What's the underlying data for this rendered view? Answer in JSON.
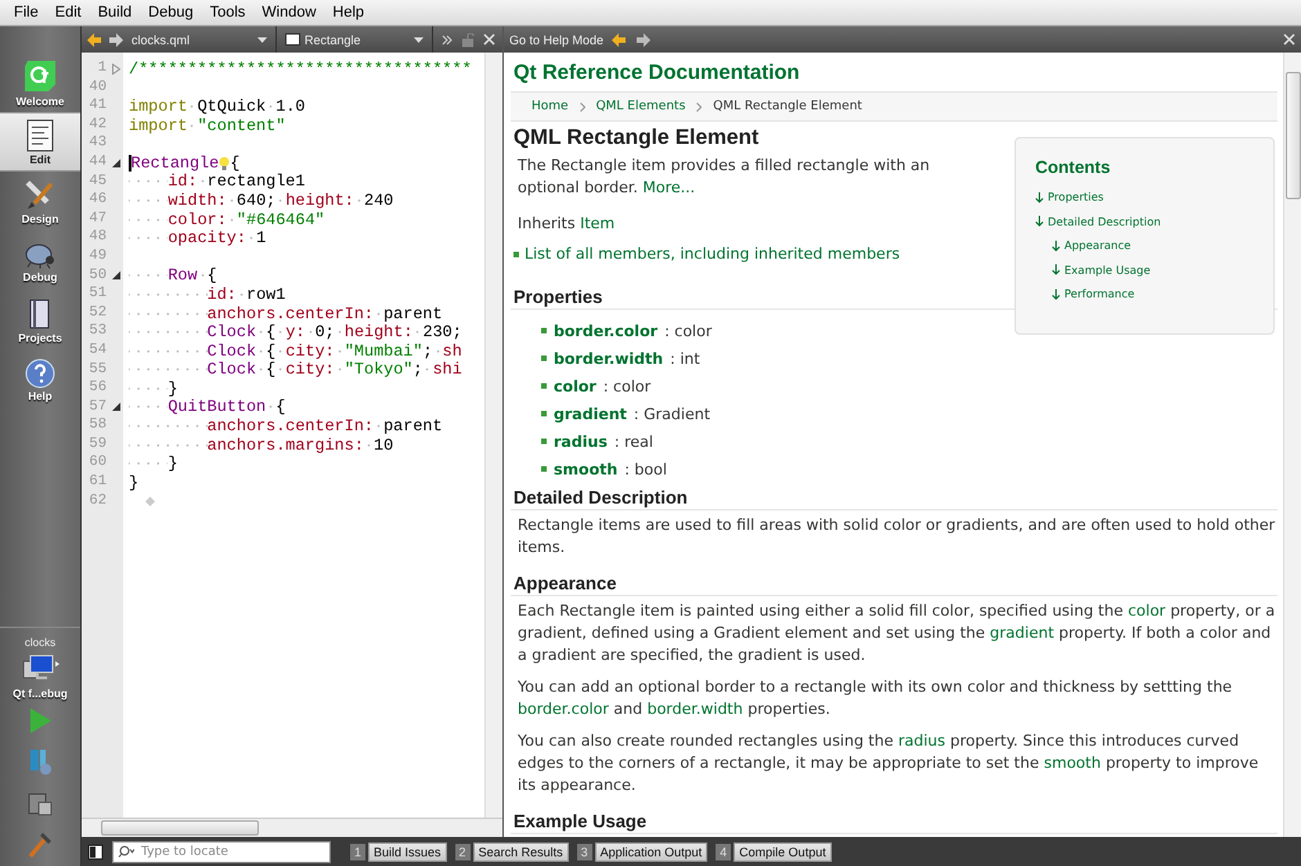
{
  "menu": [
    "File",
    "Edit",
    "Build",
    "Debug",
    "Tools",
    "Window",
    "Help"
  ],
  "modes": [
    {
      "label": "Welcome",
      "kind": "qt",
      "selected": false
    },
    {
      "label": "Edit",
      "kind": "edit",
      "selected": true
    },
    {
      "label": "Design",
      "kind": "design",
      "selected": false
    },
    {
      "label": "Debug",
      "kind": "debug",
      "selected": false
    },
    {
      "label": "Projects",
      "kind": "projects",
      "selected": false
    },
    {
      "label": "Help",
      "kind": "help",
      "selected": false
    }
  ],
  "target": {
    "project": "clocks",
    "kit": "Qt f...ebug"
  },
  "actions": [
    {
      "kind": "run"
    },
    {
      "kind": "debug"
    },
    {
      "kind": "deploy"
    },
    {
      "kind": "build"
    }
  ],
  "editor": {
    "file": "clocks.qml",
    "symbol": "Rectangle",
    "lines": [
      {
        "num": "1",
        "collapsed": true,
        "tokens": [
          {
            "kind": "comment",
            "t": "/**********************************"
          }
        ]
      },
      {
        "num": "40"
      },
      {
        "num": "41",
        "tokens": [
          {
            "kind": "keyword",
            "t": "import"
          },
          {
            "kind": "plain",
            "t": " QtQuick 1.0"
          }
        ]
      },
      {
        "num": "42",
        "tokens": [
          {
            "kind": "keyword",
            "t": "import"
          },
          {
            "kind": "string",
            "t": " \"content\""
          }
        ]
      },
      {
        "num": "43"
      },
      {
        "num": "44",
        "collapsed": false,
        "tokens": [
          {
            "kind": "cursor"
          },
          {
            "kind": "type",
            "t": "Rectangle"
          },
          {
            "kind": "hint"
          },
          {
            "kind": "plain",
            "t": "{"
          }
        ]
      },
      {
        "num": "45",
        "tokens": [
          {
            "kind": "property",
            "t": "    id:"
          },
          {
            "kind": "plain",
            "t": " rectangle1"
          }
        ]
      },
      {
        "num": "46",
        "tokens": [
          {
            "kind": "property",
            "t": "    width:"
          },
          {
            "kind": "plain",
            "t": " 640;"
          },
          {
            "kind": "property",
            "t": " height:"
          },
          {
            "kind": "plain",
            "t": " 240"
          }
        ]
      },
      {
        "num": "47",
        "tokens": [
          {
            "kind": "property",
            "t": "    color:"
          },
          {
            "kind": "string",
            "t": " \"#646464\""
          }
        ]
      },
      {
        "num": "48",
        "tokens": [
          {
            "kind": "property",
            "t": "    opacity:"
          },
          {
            "kind": "plain",
            "t": " 1"
          }
        ]
      },
      {
        "num": "49"
      },
      {
        "num": "50",
        "collapsed": false,
        "tokens": [
          {
            "kind": "type",
            "t": "    Row"
          },
          {
            "kind": "plain",
            "t": " {"
          }
        ]
      },
      {
        "num": "51",
        "tokens": [
          {
            "kind": "property",
            "t": "        id:"
          },
          {
            "kind": "plain",
            "t": " row1"
          }
        ]
      },
      {
        "num": "52",
        "tokens": [
          {
            "kind": "property",
            "t": "        anchors.centerIn:"
          },
          {
            "kind": "plain",
            "t": " parent"
          }
        ]
      },
      {
        "num": "53",
        "tokens": [
          {
            "kind": "type",
            "t": "        Clock"
          },
          {
            "kind": "plain",
            "t": " {"
          },
          {
            "kind": "property",
            "t": " y:"
          },
          {
            "kind": "plain",
            "t": " 0;"
          },
          {
            "kind": "property",
            "t": " height:"
          },
          {
            "kind": "plain",
            "t": " 230;"
          }
        ]
      },
      {
        "num": "54",
        "tokens": [
          {
            "kind": "type",
            "t": "        Clock"
          },
          {
            "kind": "plain",
            "t": " {"
          },
          {
            "kind": "property",
            "t": " city:"
          },
          {
            "kind": "string",
            "t": " \"Mumbai\""
          },
          {
            "kind": "plain",
            "t": ";"
          },
          {
            "kind": "property",
            "t": " sh"
          }
        ]
      },
      {
        "num": "55",
        "tokens": [
          {
            "kind": "type",
            "t": "        Clock"
          },
          {
            "kind": "plain",
            "t": " {"
          },
          {
            "kind": "property",
            "t": " city:"
          },
          {
            "kind": "string",
            "t": " \"Tokyo\""
          },
          {
            "kind": "plain",
            "t": ";"
          },
          {
            "kind": "property",
            "t": " shi"
          }
        ]
      },
      {
        "num": "56",
        "tokens": [
          {
            "kind": "plain",
            "t": "    }"
          }
        ]
      },
      {
        "num": "57",
        "collapsed": false,
        "tokens": [
          {
            "kind": "type",
            "t": "    QuitButton"
          },
          {
            "kind": "plain",
            "t": " {"
          }
        ]
      },
      {
        "num": "58",
        "tokens": [
          {
            "kind": "property",
            "t": "        anchors.centerIn:"
          },
          {
            "kind": "plain",
            "t": " parent"
          }
        ]
      },
      {
        "num": "59",
        "tokens": [
          {
            "kind": "property",
            "t": "        anchors.margins:"
          },
          {
            "kind": "plain",
            "t": " 10"
          }
        ]
      },
      {
        "num": "60",
        "tokens": [
          {
            "kind": "plain",
            "t": "    }"
          }
        ]
      },
      {
        "num": "61",
        "tokens": [
          {
            "kind": "plain",
            "t": "}"
          }
        ]
      },
      {
        "num": "62",
        "marker": true
      }
    ]
  },
  "help": {
    "toolbar_title": "Go to Help Mode",
    "title": "Qt Reference Documentation",
    "breadcrumb": [
      {
        "label": "Home",
        "link": true
      },
      {
        "label": "QML Elements",
        "link": true
      },
      {
        "label": "QML Rectangle Element",
        "link": false
      }
    ],
    "heading": "QML Rectangle Element",
    "contents": {
      "title": "Contents",
      "items": [
        {
          "label": "Properties"
        },
        {
          "label": "Detailed Description",
          "children": [
            {
              "label": "Appearance"
            },
            {
              "label": "Example Usage"
            },
            {
              "label": "Performance"
            }
          ]
        }
      ]
    },
    "summary": [
      {
        "kind": "para",
        "segments": [
          {
            "t": "The Rectangle item provides a filled rectangle with an optional border. "
          },
          {
            "t": "More...",
            "link": true
          }
        ]
      },
      {
        "kind": "para",
        "segments": [
          {
            "t": "Inherits "
          },
          {
            "t": "Item",
            "link": true
          }
        ]
      },
      {
        "kind": "bullet-link",
        "text": "List of all members, including inherited members"
      }
    ],
    "blocks": [
      {
        "kind": "h2",
        "text": "Properties"
      },
      {
        "kind": "props",
        "items": [
          {
            "name": "border.color",
            "type": ": color"
          },
          {
            "name": "border.width",
            "type": ": int"
          },
          {
            "name": "color",
            "type": ": color"
          },
          {
            "name": "gradient",
            "type": ": Gradient"
          },
          {
            "name": "radius",
            "type": ": real"
          },
          {
            "name": "smooth",
            "type": ": bool"
          }
        ]
      },
      {
        "kind": "h2",
        "text": "Detailed Description"
      },
      {
        "kind": "para",
        "segments": [
          {
            "t": "Rectangle items are used to fill areas with solid color or gradients, and are often used to hold other items."
          }
        ]
      },
      {
        "kind": "h2",
        "text": "Appearance"
      },
      {
        "kind": "para",
        "segments": [
          {
            "t": "Each Rectangle item is painted using either a solid fill color, specified using the "
          },
          {
            "t": "color",
            "link": true
          },
          {
            "t": " property, or a gradient, defined using a Gradient element and set using the "
          },
          {
            "t": "gradient",
            "link": true
          },
          {
            "t": " property. If both a color and a gradient are specified, the gradient is used."
          }
        ]
      },
      {
        "kind": "para",
        "segments": [
          {
            "t": "You can add an optional border to a rectangle with its own color and thickness by settting the "
          },
          {
            "t": "border.color",
            "link": true
          },
          {
            "t": " and "
          },
          {
            "t": "border.width",
            "link": true
          },
          {
            "t": " properties."
          }
        ]
      },
      {
        "kind": "para",
        "segments": [
          {
            "t": "You can also create rounded rectangles using the "
          },
          {
            "t": "radius",
            "link": true
          },
          {
            "t": " property. Since this introduces curved edges to the corners of a rectangle, it may be appropriate to set the "
          },
          {
            "t": "smooth",
            "link": true
          },
          {
            "t": " property to improve its appearance."
          }
        ]
      },
      {
        "kind": "h2",
        "text": "Example Usage"
      }
    ]
  },
  "status": {
    "locate_placeholder": "Type to locate",
    "panes": [
      {
        "num": "1",
        "label": "Build Issues"
      },
      {
        "num": "2",
        "label": "Search Results"
      },
      {
        "num": "3",
        "label": "Application Output"
      },
      {
        "num": "4",
        "label": "Compile Output"
      }
    ]
  }
}
